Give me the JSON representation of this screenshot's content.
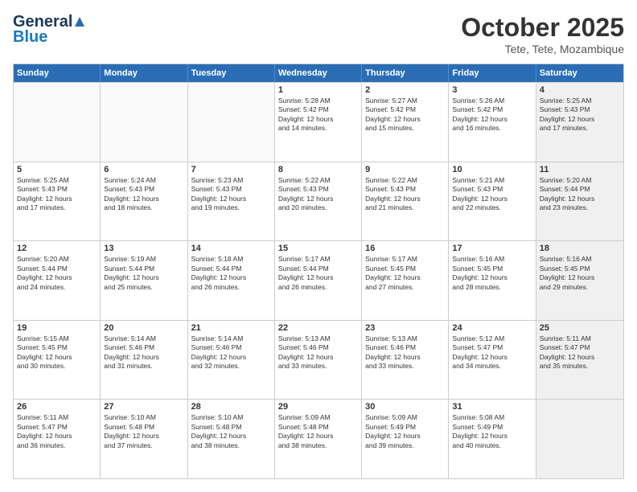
{
  "header": {
    "logo": {
      "general": "General",
      "blue": "Blue"
    },
    "title": "October 2025",
    "location": "Tete, Tete, Mozambique"
  },
  "weekdays": [
    "Sunday",
    "Monday",
    "Tuesday",
    "Wednesday",
    "Thursday",
    "Friday",
    "Saturday"
  ],
  "rows": [
    [
      {
        "day": "",
        "text": "",
        "empty": true
      },
      {
        "day": "",
        "text": "",
        "empty": true
      },
      {
        "day": "",
        "text": "",
        "empty": true
      },
      {
        "day": "1",
        "text": "Sunrise: 5:28 AM\nSunset: 5:42 PM\nDaylight: 12 hours\nand 14 minutes."
      },
      {
        "day": "2",
        "text": "Sunrise: 5:27 AM\nSunset: 5:42 PM\nDaylight: 12 hours\nand 15 minutes."
      },
      {
        "day": "3",
        "text": "Sunrise: 5:26 AM\nSunset: 5:42 PM\nDaylight: 12 hours\nand 16 minutes."
      },
      {
        "day": "4",
        "text": "Sunrise: 5:25 AM\nSunset: 5:43 PM\nDaylight: 12 hours\nand 17 minutes.",
        "shaded": true
      }
    ],
    [
      {
        "day": "5",
        "text": "Sunrise: 5:25 AM\nSunset: 5:43 PM\nDaylight: 12 hours\nand 17 minutes."
      },
      {
        "day": "6",
        "text": "Sunrise: 5:24 AM\nSunset: 5:43 PM\nDaylight: 12 hours\nand 18 minutes."
      },
      {
        "day": "7",
        "text": "Sunrise: 5:23 AM\nSunset: 5:43 PM\nDaylight: 12 hours\nand 19 minutes."
      },
      {
        "day": "8",
        "text": "Sunrise: 5:22 AM\nSunset: 5:43 PM\nDaylight: 12 hours\nand 20 minutes."
      },
      {
        "day": "9",
        "text": "Sunrise: 5:22 AM\nSunset: 5:43 PM\nDaylight: 12 hours\nand 21 minutes."
      },
      {
        "day": "10",
        "text": "Sunrise: 5:21 AM\nSunset: 5:43 PM\nDaylight: 12 hours\nand 22 minutes."
      },
      {
        "day": "11",
        "text": "Sunrise: 5:20 AM\nSunset: 5:44 PM\nDaylight: 12 hours\nand 23 minutes.",
        "shaded": true
      }
    ],
    [
      {
        "day": "12",
        "text": "Sunrise: 5:20 AM\nSunset: 5:44 PM\nDaylight: 12 hours\nand 24 minutes."
      },
      {
        "day": "13",
        "text": "Sunrise: 5:19 AM\nSunset: 5:44 PM\nDaylight: 12 hours\nand 25 minutes."
      },
      {
        "day": "14",
        "text": "Sunrise: 5:18 AM\nSunset: 5:44 PM\nDaylight: 12 hours\nand 26 minutes."
      },
      {
        "day": "15",
        "text": "Sunrise: 5:17 AM\nSunset: 5:44 PM\nDaylight: 12 hours\nand 26 minutes."
      },
      {
        "day": "16",
        "text": "Sunrise: 5:17 AM\nSunset: 5:45 PM\nDaylight: 12 hours\nand 27 minutes."
      },
      {
        "day": "17",
        "text": "Sunrise: 5:16 AM\nSunset: 5:45 PM\nDaylight: 12 hours\nand 28 minutes."
      },
      {
        "day": "18",
        "text": "Sunrise: 5:16 AM\nSunset: 5:45 PM\nDaylight: 12 hours\nand 29 minutes.",
        "shaded": true
      }
    ],
    [
      {
        "day": "19",
        "text": "Sunrise: 5:15 AM\nSunset: 5:45 PM\nDaylight: 12 hours\nand 30 minutes."
      },
      {
        "day": "20",
        "text": "Sunrise: 5:14 AM\nSunset: 5:46 PM\nDaylight: 12 hours\nand 31 minutes."
      },
      {
        "day": "21",
        "text": "Sunrise: 5:14 AM\nSunset: 5:46 PM\nDaylight: 12 hours\nand 32 minutes."
      },
      {
        "day": "22",
        "text": "Sunrise: 5:13 AM\nSunset: 5:46 PM\nDaylight: 12 hours\nand 33 minutes."
      },
      {
        "day": "23",
        "text": "Sunrise: 5:13 AM\nSunset: 5:46 PM\nDaylight: 12 hours\nand 33 minutes."
      },
      {
        "day": "24",
        "text": "Sunrise: 5:12 AM\nSunset: 5:47 PM\nDaylight: 12 hours\nand 34 minutes."
      },
      {
        "day": "25",
        "text": "Sunrise: 5:11 AM\nSunset: 5:47 PM\nDaylight: 12 hours\nand 35 minutes.",
        "shaded": true
      }
    ],
    [
      {
        "day": "26",
        "text": "Sunrise: 5:11 AM\nSunset: 5:47 PM\nDaylight: 12 hours\nand 36 minutes."
      },
      {
        "day": "27",
        "text": "Sunrise: 5:10 AM\nSunset: 5:48 PM\nDaylight: 12 hours\nand 37 minutes."
      },
      {
        "day": "28",
        "text": "Sunrise: 5:10 AM\nSunset: 5:48 PM\nDaylight: 12 hours\nand 38 minutes."
      },
      {
        "day": "29",
        "text": "Sunrise: 5:09 AM\nSunset: 5:48 PM\nDaylight: 12 hours\nand 38 minutes."
      },
      {
        "day": "30",
        "text": "Sunrise: 5:09 AM\nSunset: 5:49 PM\nDaylight: 12 hours\nand 39 minutes."
      },
      {
        "day": "31",
        "text": "Sunrise: 5:08 AM\nSunset: 5:49 PM\nDaylight: 12 hours\nand 40 minutes."
      },
      {
        "day": "",
        "text": "",
        "empty": true,
        "shaded": true
      }
    ]
  ]
}
